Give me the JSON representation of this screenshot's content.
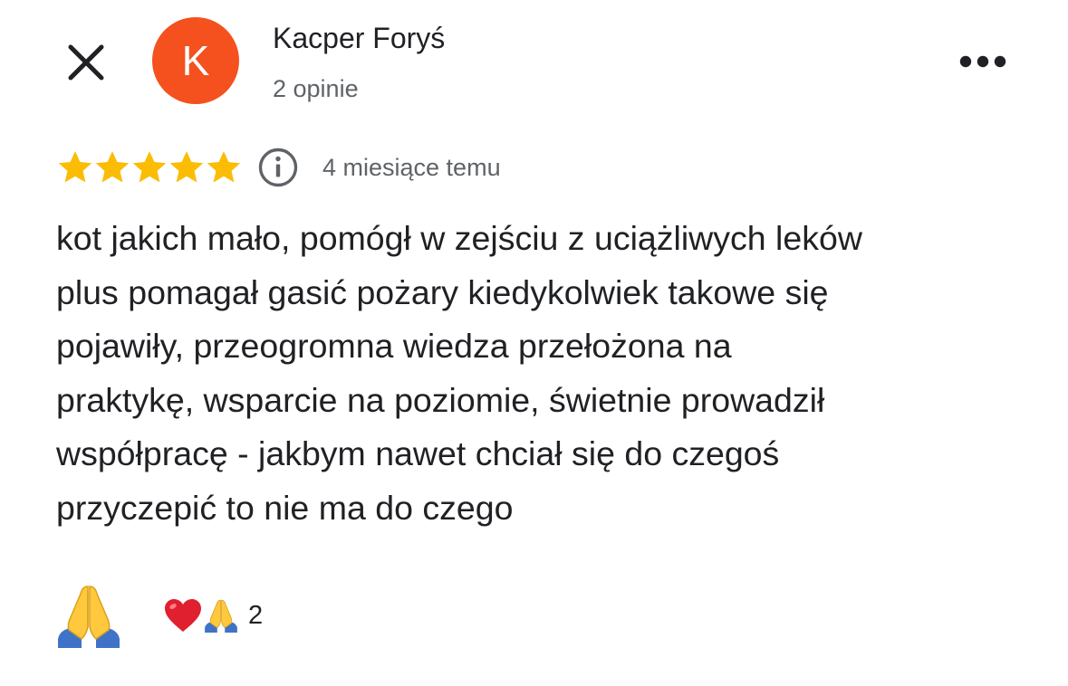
{
  "header": {
    "avatar_letter": "K",
    "author_name": "Kacper Foryś",
    "review_count": "2 opinie"
  },
  "icons": {
    "close": "close-icon",
    "more": "more-options-icon",
    "info": "info-icon",
    "star": "star-icon",
    "praying_hands": "praying-hands-icon",
    "heart": "heart-icon"
  },
  "colors": {
    "avatar_bg": "#f4511e",
    "star": "#fbbc04",
    "secondary_text": "#5f6368",
    "primary_text": "#202124"
  },
  "review": {
    "rating": 5,
    "rating_max": 5,
    "date": "4 miesiące temu",
    "text_lines": [
      "kot jakich mało, pomógł w zejściu z uciążliwych leków",
      "plus pomagał gasić pożary kiedykolwiek takowe się",
      "pojawiły, przeogromna wiedza przełożona na",
      "praktykę, wsparcie na poziomie, świetnie prowadził",
      "współpracę - jakbym nawet chciał się do czegoś",
      "przyczepić to nie ma do czego"
    ]
  },
  "reactions": {
    "summary_count": "2"
  }
}
